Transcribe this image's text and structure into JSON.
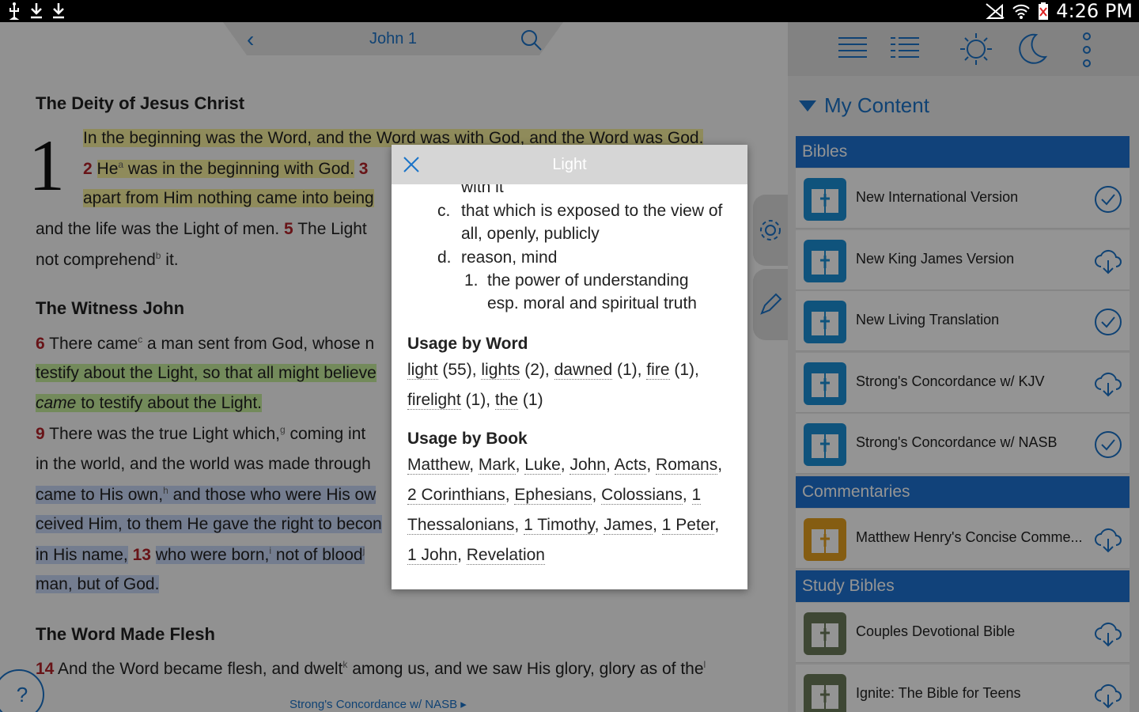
{
  "status_bar": {
    "time": "4:26 PM"
  },
  "reader": {
    "reference": "John 1",
    "chapter_number": "1",
    "heading1": "The Deity of Jesus Christ",
    "heading2": "The Witness John",
    "heading3": "The Word Made Flesh",
    "lines": {
      "l1": "In the beginning was the Word, and the Word was with God, and the Word was God.",
      "l2_v": "2",
      "l2a": "He",
      "l2_fn": "a",
      "l2b": " was in the beginning with God.",
      "l2_v3": "3",
      "l3": "apart from Him nothing came into being",
      "l4a": "and the life was the Light of men.",
      "l4_v": "5",
      "l4b": "The Light",
      "l5a": "not comprehend",
      "l5_fn": "b",
      "l5b": " it.",
      "l6_v": "6",
      "l6a": "There came",
      "l6_fn": "c",
      "l6b": " a man sent from God, whose n",
      "l7": "testify about the Light, so that all might believe",
      "l8a": "came",
      "l8b": " to testify about the Light.",
      "l9_v": "9",
      "l9a": "There was the true Light which,",
      "l9_fn": "g",
      "l9b": " coming int",
      "l10": "in the world, and the world was made through",
      "l11a": "came to His own,",
      "l11_fn": "h",
      "l11b": " and those who were His ow",
      "l12": "ceived Him, to them He gave the right to becon",
      "l13a": "in His name,",
      "l13_v": "13",
      "l13b": "who were born,",
      "l13_fn": "i",
      "l13c": " not of blood",
      "l13_fn2": "j",
      "l14": "man, but of God.",
      "l15_v": "14",
      "l15a": "And the Word became flesh, and dwelt",
      "l15_fn": "k",
      "l15b": " among us, and we saw His glory, glory as of the",
      "l15_fn2": "l"
    },
    "bottom_link": "Strong's Concordance w/ NASB ▸",
    "help_label": "?"
  },
  "panel": {
    "title": "My Content",
    "sections": {
      "bibles": "Bibles",
      "commentaries": "Commentaries",
      "study_bibles": "Study Bibles"
    },
    "bibles": [
      {
        "name": "New International Version",
        "status": "installed"
      },
      {
        "name": "New King James Version",
        "status": "download"
      },
      {
        "name": "New Living Translation",
        "status": "installed"
      },
      {
        "name": "Strong's Concordance w/ KJV",
        "status": "download"
      },
      {
        "name": "Strong's Concordance w/ NASB",
        "status": "installed"
      }
    ],
    "commentaries": [
      {
        "name": "Matthew Henry's Concise Comme...",
        "status": "download"
      }
    ],
    "study_bibles": [
      {
        "name": "Couples Devotional Bible",
        "status": "download"
      },
      {
        "name": "Ignite: The Bible for Teens",
        "status": "download"
      }
    ],
    "colors": {
      "accent": "#1e73d2",
      "book": "#1a8fd6",
      "commentary": "#e6a020"
    }
  },
  "dialog": {
    "title": "Light",
    "def_top": "with it",
    "def_c_label": "c.",
    "def_c1": "that which is exposed to the view of",
    "def_c2": "all, openly, publicly",
    "def_d_label": "d.",
    "def_d": "reason, mind",
    "def_1_label": "1.",
    "def_11": "the power of understanding",
    "def_12": "esp. moral and spiritual truth",
    "usage_word_heading": "Usage by Word",
    "usage_word": [
      {
        "word": "light",
        "count": "(55)"
      },
      {
        "word": "lights",
        "count": "(2)"
      },
      {
        "word": "dawned",
        "count": "(1)"
      },
      {
        "word": "fire",
        "count": "(1)"
      },
      {
        "word": "firelight",
        "count": "(1)"
      },
      {
        "word": "the",
        "count": "(1)"
      }
    ],
    "usage_book_heading": "Usage by Book",
    "usage_book": [
      "Matthew",
      "Mark",
      "Luke",
      "John",
      "Acts",
      "Romans",
      "2 Corinthians",
      "Ephesians",
      "Colossians",
      "1 Thessalonians",
      "1 Timothy",
      "James",
      "1 Peter",
      "1 John",
      "Revelation"
    ]
  }
}
